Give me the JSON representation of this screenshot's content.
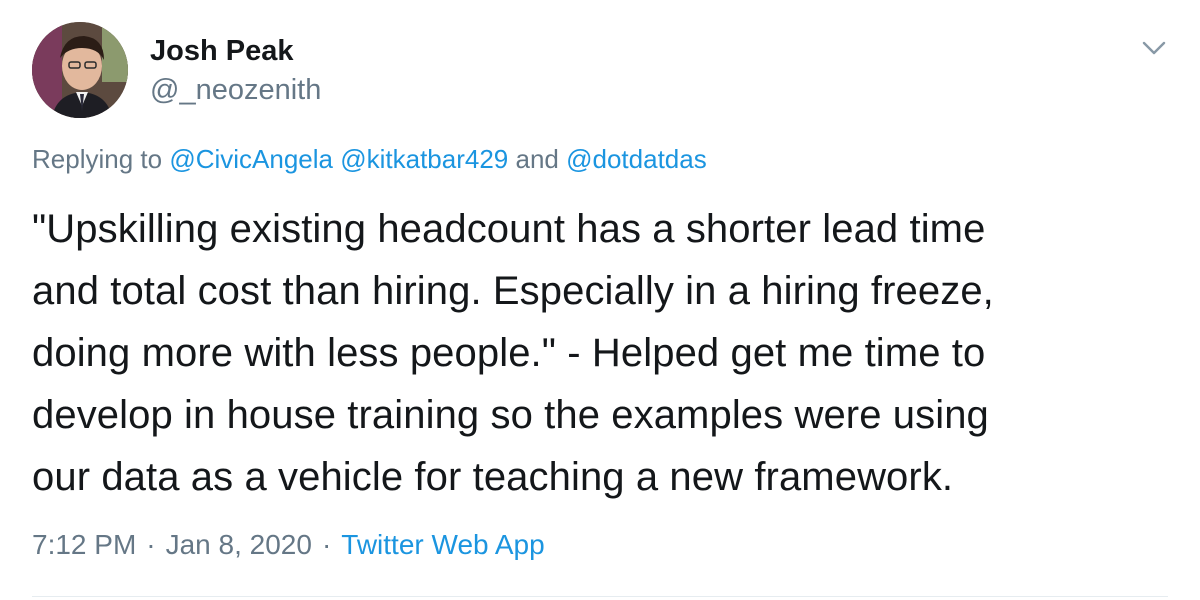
{
  "author": {
    "name": "Josh Peak",
    "handle": "@_neozenith"
  },
  "reply_context": {
    "prefix": "Replying to ",
    "mentions": [
      "@CivicAngela",
      "@kitkatbar429",
      "@dotdatdas"
    ],
    "joiner": " and "
  },
  "tweet": {
    "lines": [
      "\"Upskilling existing headcount has a shorter lead time",
      "and total cost than hiring. Especially in a hiring freeze,",
      "doing more with less people.\" - Helped get me time to",
      "develop in house training so the examples were using",
      "our data as a vehicle for teaching a new framework."
    ]
  },
  "meta": {
    "time": "7:12 PM",
    "date": "Jan 8, 2020",
    "separator": "·",
    "source": "Twitter Web App"
  },
  "icons": {
    "caret": "chevron-down-icon"
  },
  "colors": {
    "link": "#1b95e0",
    "secondary_text": "#657786",
    "primary_text": "#14171a"
  }
}
